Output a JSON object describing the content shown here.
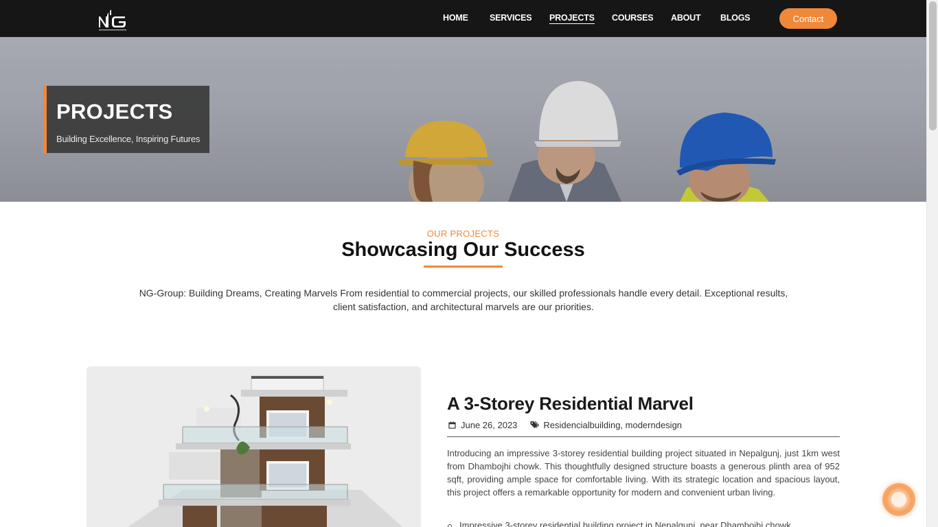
{
  "brand": {
    "logo_text": "NG"
  },
  "nav": {
    "items": [
      {
        "label": "HOME",
        "active": false
      },
      {
        "label": "SERVICES",
        "active": false
      },
      {
        "label": "PROJECTS",
        "active": true
      },
      {
        "label": "COURSES",
        "active": false
      },
      {
        "label": "ABOUT",
        "active": false
      },
      {
        "label": "BLOGS",
        "active": false
      }
    ],
    "contact_label": "Contact"
  },
  "hero": {
    "title": "PROJECTS",
    "subtitle": "Building Excellence, Inspiring Futures"
  },
  "section": {
    "tag": "OUR PROJECTS",
    "title": "Showcasing Our Success",
    "description": "NG-Group: Building Dreams, Creating Marvels From residential to commercial projects, our skilled professionals handle every detail. Exceptional results, client satisfaction, and architectural marvels are our priorities."
  },
  "project": {
    "title": "A 3-Storey Residential Marvel",
    "date": "June 26, 2023",
    "tags": "Residencialbuilding, moderndesign",
    "description": "Introducing an impressive 3-storey residential building project situated in Nepalgunj, just 1km west from Dhambojhi chowk. This thoughtfully designed structure boasts a generous plinth area of 952 sqft, providing ample space for comfortable living. With its strategic location and spacious layout, this project offers a remarkable opportunity for modern and convenient urban living.",
    "bullets": [
      "Impressive 3-storey residential building project in Nepalgunj, near Dhambojhi chowk."
    ]
  },
  "colors": {
    "accent": "#f0883a",
    "navbar": "#161616"
  },
  "icons": {
    "date": "calendar-icon",
    "tags": "tag-icon"
  }
}
